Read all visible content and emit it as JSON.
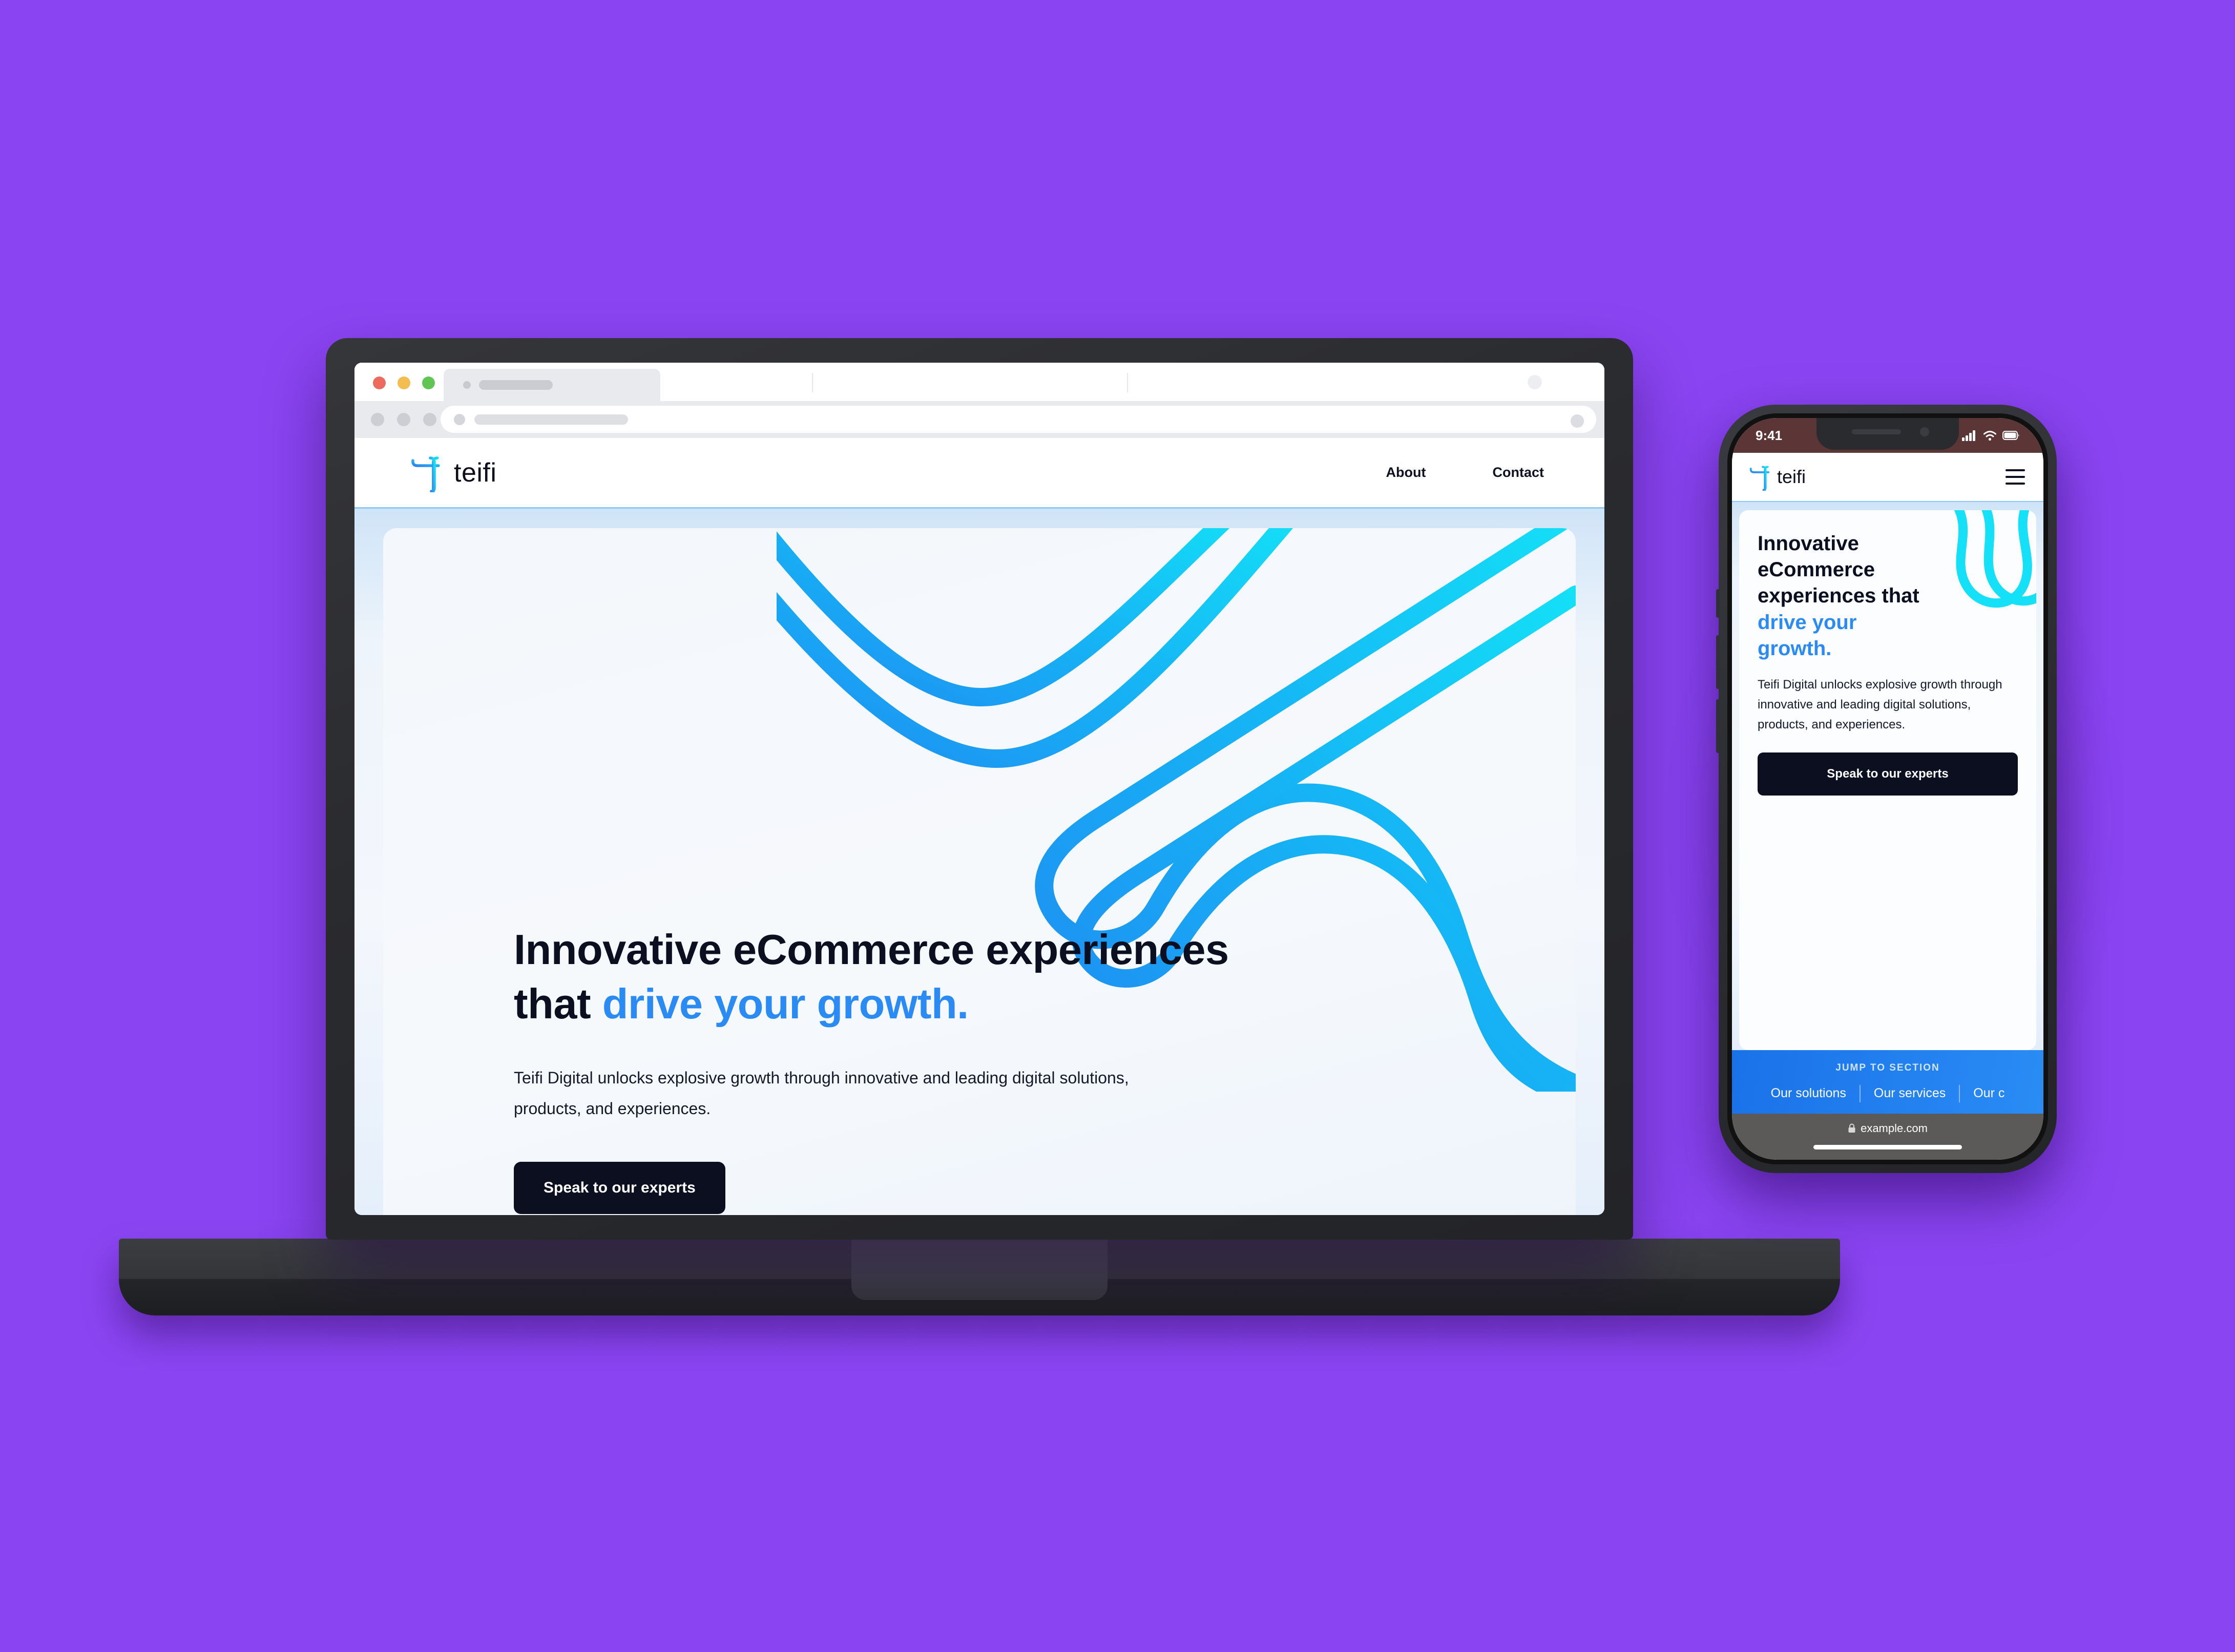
{
  "background": {
    "color": "#8b44f2"
  },
  "brand": {
    "accent_blue": "#2b8bf5",
    "logo_cyan": "#19e3f0",
    "logo_blue": "#2b8bf5",
    "dark": "#0b0f1f"
  },
  "laptop": {
    "browser": {
      "traffic_lights": [
        "close-red",
        "minimize-yellow",
        "maximize-green"
      ],
      "tab_placeholder": "",
      "address_placeholder": ""
    },
    "site_header": {
      "logo_text": "teifi",
      "nav": [
        {
          "label": "About"
        },
        {
          "label": "Contact"
        }
      ]
    },
    "hero": {
      "headline_line1": "Innovative eCommerce experiences",
      "headline_line2_plain": "that ",
      "headline_line2_accent": "drive your growth.",
      "body": "Teifi Digital unlocks explosive growth through innovative and leading digital solutions, products, and experiences.",
      "cta_label": "Speak to our experts"
    }
  },
  "phone": {
    "status_bar": {
      "time": "9:41",
      "icons": [
        "cellular-signal-icon",
        "wifi-icon",
        "battery-icon"
      ],
      "background": "#5c3636"
    },
    "site_header": {
      "logo_text": "teifi",
      "menu_icon": "hamburger-menu-icon"
    },
    "hero": {
      "headline_line1": "Innovative",
      "headline_line2": "eCommerce",
      "headline_line3": "experiences that",
      "headline_accent_line1": "drive your",
      "headline_accent_line2": "growth.",
      "body": "Teifi Digital unlocks explosive growth through innovative and leading digital solutions, products, and experiences.",
      "cta_label": "Speak to our experts"
    },
    "jump_to_section": {
      "title": "JUMP TO SECTION",
      "links": [
        {
          "label": "Our solutions"
        },
        {
          "label": "Our services"
        },
        {
          "label": "Our c"
        }
      ],
      "background": "#2a8cf5"
    },
    "safari": {
      "lock_icon": "lock-icon",
      "url": "example.com"
    }
  }
}
